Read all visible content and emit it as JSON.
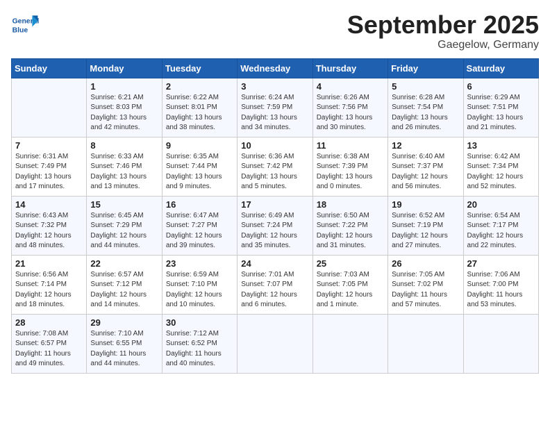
{
  "logo": {
    "general": "General",
    "blue": "Blue"
  },
  "header": {
    "month": "September 2025",
    "location": "Gaegelow, Germany"
  },
  "weekdays": [
    "Sunday",
    "Monday",
    "Tuesday",
    "Wednesday",
    "Thursday",
    "Friday",
    "Saturday"
  ],
  "weeks": [
    [
      {
        "day": "",
        "info": ""
      },
      {
        "day": "1",
        "info": "Sunrise: 6:21 AM\nSunset: 8:03 PM\nDaylight: 13 hours\nand 42 minutes."
      },
      {
        "day": "2",
        "info": "Sunrise: 6:22 AM\nSunset: 8:01 PM\nDaylight: 13 hours\nand 38 minutes."
      },
      {
        "day": "3",
        "info": "Sunrise: 6:24 AM\nSunset: 7:59 PM\nDaylight: 13 hours\nand 34 minutes."
      },
      {
        "day": "4",
        "info": "Sunrise: 6:26 AM\nSunset: 7:56 PM\nDaylight: 13 hours\nand 30 minutes."
      },
      {
        "day": "5",
        "info": "Sunrise: 6:28 AM\nSunset: 7:54 PM\nDaylight: 13 hours\nand 26 minutes."
      },
      {
        "day": "6",
        "info": "Sunrise: 6:29 AM\nSunset: 7:51 PM\nDaylight: 13 hours\nand 21 minutes."
      }
    ],
    [
      {
        "day": "7",
        "info": "Sunrise: 6:31 AM\nSunset: 7:49 PM\nDaylight: 13 hours\nand 17 minutes."
      },
      {
        "day": "8",
        "info": "Sunrise: 6:33 AM\nSunset: 7:46 PM\nDaylight: 13 hours\nand 13 minutes."
      },
      {
        "day": "9",
        "info": "Sunrise: 6:35 AM\nSunset: 7:44 PM\nDaylight: 13 hours\nand 9 minutes."
      },
      {
        "day": "10",
        "info": "Sunrise: 6:36 AM\nSunset: 7:42 PM\nDaylight: 13 hours\nand 5 minutes."
      },
      {
        "day": "11",
        "info": "Sunrise: 6:38 AM\nSunset: 7:39 PM\nDaylight: 13 hours\nand 0 minutes."
      },
      {
        "day": "12",
        "info": "Sunrise: 6:40 AM\nSunset: 7:37 PM\nDaylight: 12 hours\nand 56 minutes."
      },
      {
        "day": "13",
        "info": "Sunrise: 6:42 AM\nSunset: 7:34 PM\nDaylight: 12 hours\nand 52 minutes."
      }
    ],
    [
      {
        "day": "14",
        "info": "Sunrise: 6:43 AM\nSunset: 7:32 PM\nDaylight: 12 hours\nand 48 minutes."
      },
      {
        "day": "15",
        "info": "Sunrise: 6:45 AM\nSunset: 7:29 PM\nDaylight: 12 hours\nand 44 minutes."
      },
      {
        "day": "16",
        "info": "Sunrise: 6:47 AM\nSunset: 7:27 PM\nDaylight: 12 hours\nand 39 minutes."
      },
      {
        "day": "17",
        "info": "Sunrise: 6:49 AM\nSunset: 7:24 PM\nDaylight: 12 hours\nand 35 minutes."
      },
      {
        "day": "18",
        "info": "Sunrise: 6:50 AM\nSunset: 7:22 PM\nDaylight: 12 hours\nand 31 minutes."
      },
      {
        "day": "19",
        "info": "Sunrise: 6:52 AM\nSunset: 7:19 PM\nDaylight: 12 hours\nand 27 minutes."
      },
      {
        "day": "20",
        "info": "Sunrise: 6:54 AM\nSunset: 7:17 PM\nDaylight: 12 hours\nand 22 minutes."
      }
    ],
    [
      {
        "day": "21",
        "info": "Sunrise: 6:56 AM\nSunset: 7:14 PM\nDaylight: 12 hours\nand 18 minutes."
      },
      {
        "day": "22",
        "info": "Sunrise: 6:57 AM\nSunset: 7:12 PM\nDaylight: 12 hours\nand 14 minutes."
      },
      {
        "day": "23",
        "info": "Sunrise: 6:59 AM\nSunset: 7:10 PM\nDaylight: 12 hours\nand 10 minutes."
      },
      {
        "day": "24",
        "info": "Sunrise: 7:01 AM\nSunset: 7:07 PM\nDaylight: 12 hours\nand 6 minutes."
      },
      {
        "day": "25",
        "info": "Sunrise: 7:03 AM\nSunset: 7:05 PM\nDaylight: 12 hours\nand 1 minute."
      },
      {
        "day": "26",
        "info": "Sunrise: 7:05 AM\nSunset: 7:02 PM\nDaylight: 11 hours\nand 57 minutes."
      },
      {
        "day": "27",
        "info": "Sunrise: 7:06 AM\nSunset: 7:00 PM\nDaylight: 11 hours\nand 53 minutes."
      }
    ],
    [
      {
        "day": "28",
        "info": "Sunrise: 7:08 AM\nSunset: 6:57 PM\nDaylight: 11 hours\nand 49 minutes."
      },
      {
        "day": "29",
        "info": "Sunrise: 7:10 AM\nSunset: 6:55 PM\nDaylight: 11 hours\nand 44 minutes."
      },
      {
        "day": "30",
        "info": "Sunrise: 7:12 AM\nSunset: 6:52 PM\nDaylight: 11 hours\nand 40 minutes."
      },
      {
        "day": "",
        "info": ""
      },
      {
        "day": "",
        "info": ""
      },
      {
        "day": "",
        "info": ""
      },
      {
        "day": "",
        "info": ""
      }
    ]
  ]
}
